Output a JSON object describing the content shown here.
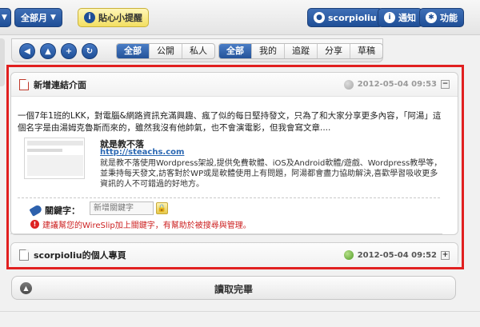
{
  "topbar": {
    "month_label": "全部月",
    "reminder_label": "貼心小提醒",
    "user_label": "scorpioliu",
    "notify_label": "通知",
    "features_label": "功能"
  },
  "toolbar": {
    "filter1": [
      "全部",
      "公開",
      "私人"
    ],
    "filter2": [
      "全部",
      "我的",
      "追蹤",
      "分享",
      "草稿"
    ]
  },
  "post1": {
    "title": "新增連結介面",
    "date": "2012-05-04 09:53",
    "collapse_symbol": "−",
    "description": "一個7年1班的LKK，對電腦&網路資訊充滿興趣、瘋了似的每日堅持發文，只為了和大家分享更多內容，「阿湯」這個名字是由湯姆克魯斯而來的，雖然我沒有他帥氣，也不會演電影，但我會寫文章....",
    "link": {
      "title": "就是教不落",
      "url": "http://steachs.com",
      "desc": "就是教不落使用Wordpress架設,提供免費軟體、iOS及Android軟體/遊戲、Wordpress教學等，並秉持每天發文,訪客對於WP或是軟體使用上有問題，阿湯都會盡力協助解決,喜歡學習吸收更多資訊的人不可錯過的好地方。"
    },
    "keyword_label": "關鍵字：",
    "keyword_placeholder": "新增關鍵字",
    "warning": "建議幫您的WireSlip加上關鍵字，有幫助於被搜尋與管理。"
  },
  "post2": {
    "title": "scorpioliu的個人專頁",
    "date": "2012-05-04 09:52",
    "expand_symbol": "+"
  },
  "read_all_label": "讀取完畢",
  "colors": {
    "accent": "#245399",
    "highlight": "#e12020",
    "reminder": "#f3df62"
  }
}
